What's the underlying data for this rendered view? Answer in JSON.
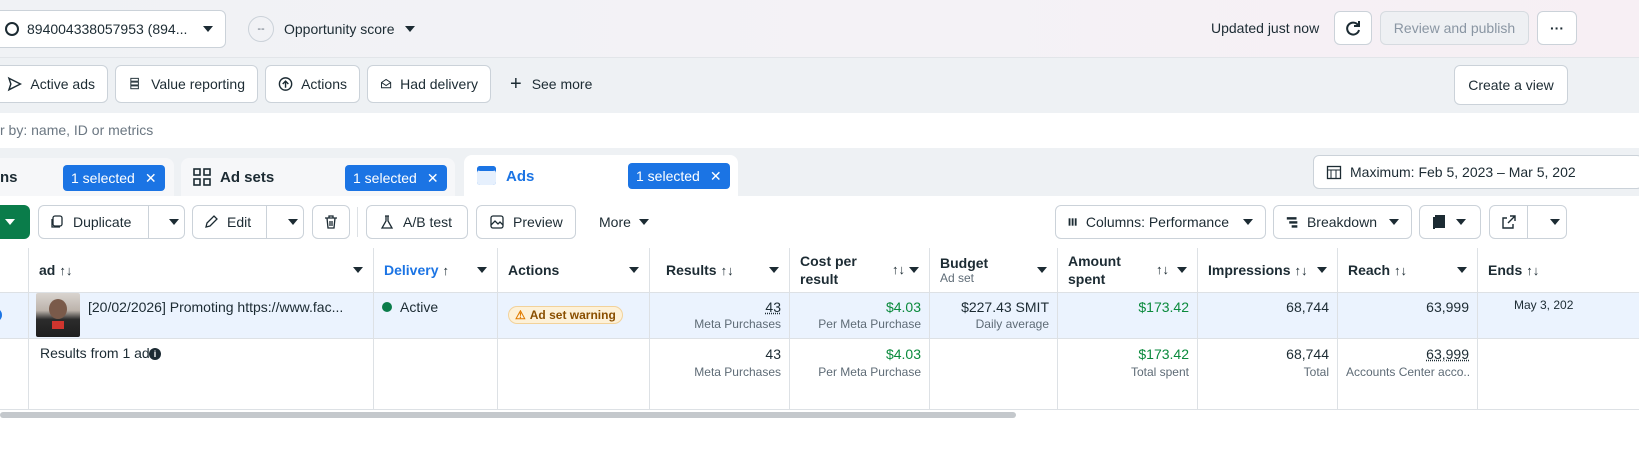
{
  "top": {
    "account_selector": "894004338057953 (894...",
    "opportunity_label": "Opportunity score",
    "opportunity_badge": "--",
    "updated_text": "Updated just now",
    "review_publish": "Review and publish",
    "more_glyph": "···"
  },
  "views": {
    "active_ads": "Active ads",
    "value_reporting": "Value reporting",
    "actions": "Actions",
    "had_delivery": "Had delivery",
    "see_more": "See more",
    "create_view": "Create a view"
  },
  "search": {
    "placeholder": "r by: name, ID or metrics"
  },
  "tabs": {
    "campaigns": {
      "label": "ns",
      "selected": "1 selected"
    },
    "adsets": {
      "label": "Ad sets",
      "selected": "1 selected"
    },
    "ads": {
      "label": "Ads",
      "selected": "1 selected"
    },
    "date_range": "Maximum: Feb 5, 2023 – Mar 5, 202"
  },
  "toolbar": {
    "duplicate": "Duplicate",
    "edit": "Edit",
    "ab_test": "A/B test",
    "preview": "Preview",
    "more": "More",
    "columns": "Columns: Performance",
    "breakdown": "Breakdown"
  },
  "table": {
    "headers": {
      "ad": "ad",
      "delivery": "Delivery",
      "actions": "Actions",
      "results": "Results",
      "cost_per_result": "Cost per result",
      "budget": "Budget",
      "budget_sub": "Ad set",
      "amount_spent": "Amount spent",
      "impressions": "Impressions",
      "reach": "Reach",
      "ends": "Ends"
    },
    "row": {
      "name": "[20/02/2026] Promoting https://www.fac...",
      "delivery": "Active",
      "actions_warning": "Ad set warning",
      "results": "43",
      "results_sub": "Meta Purchases",
      "cost": "$4.03",
      "cost_sub": "Per Meta Purchase",
      "budget": "$227.43 SMIT",
      "budget_sub": "Daily average",
      "spent": "$173.42",
      "impressions": "68,744",
      "reach": "63,999",
      "ends": "May 3, 202"
    },
    "summary": {
      "label": "Results from 1 ad",
      "results": "43",
      "results_sub": "Meta Purchases",
      "cost": "$4.03",
      "cost_sub": "Per Meta Purchase",
      "spent": "$173.42",
      "spent_sub": "Total spent",
      "impressions": "68,744",
      "impressions_sub": "Total",
      "reach": "63,999",
      "reach_sub": "Accounts Center acco..."
    }
  },
  "colors": {
    "accent": "#1b74e4",
    "publish_green": "#0a7c4a",
    "positive": "#0a8a3c",
    "warning": "#f0a000"
  }
}
